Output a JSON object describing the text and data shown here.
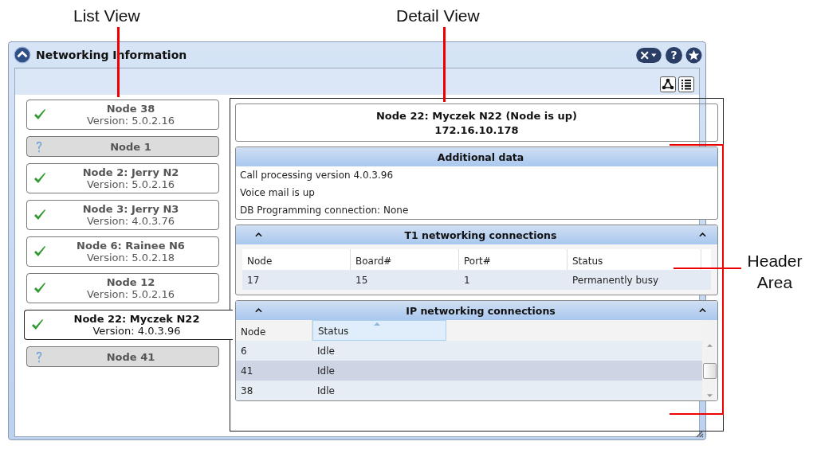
{
  "annotations": [
    {
      "label": "List View"
    },
    {
      "label": "Detail View"
    },
    {
      "label": "Header Area"
    }
  ],
  "window": {
    "title": "Networking Information",
    "help_glyph": "?"
  },
  "nodes": [
    {
      "kind": "up",
      "name": "Node 38",
      "version": "Version: 5.0.2.16",
      "selected": false
    },
    {
      "kind": "unknown",
      "name": "Node 1",
      "selected": false
    },
    {
      "kind": "up",
      "name": "Node 2: Jerry N2",
      "version": "Version: 5.0.2.16",
      "selected": false
    },
    {
      "kind": "up",
      "name": "Node 3: Jerry N3",
      "version": "Version: 4.0.3.76",
      "selected": false
    },
    {
      "kind": "up",
      "name": "Node 6: Rainee N6",
      "version": "Version: 5.0.2.18",
      "selected": false
    },
    {
      "kind": "up",
      "name": "Node 12",
      "version": "Version: 5.0.2.16",
      "selected": false
    },
    {
      "kind": "up",
      "name": "Node 22: Myczek N22",
      "version": "Version: 4.0.3.96",
      "selected": true
    },
    {
      "kind": "unknown",
      "name": "Node 41",
      "selected": false
    }
  ],
  "detail": {
    "title": "Node 22: Myczek N22 (Node is up)",
    "address": "172.16.10.178",
    "additional": {
      "title": "Additional data",
      "lines": [
        "Call processing version 4.0.3.96",
        "Voice mail is up",
        "DB Programming connection: None"
      ]
    },
    "t1": {
      "title": "T1 networking connections",
      "columns": [
        {
          "label": "Node",
          "sorted": false
        },
        {
          "label": "Board#",
          "sorted": false
        },
        {
          "label": "Port#",
          "sorted": false
        },
        {
          "label": "Status",
          "sorted": false
        }
      ],
      "rows": [
        {
          "cells": [
            "17",
            "15",
            "1",
            "Permanently busy"
          ],
          "selected": false
        }
      ]
    },
    "ip": {
      "title": "IP networking connections",
      "columns": [
        {
          "label": "Node",
          "sorted": false
        },
        {
          "label": "Status",
          "sorted": true
        }
      ],
      "rows": [
        {
          "cells": [
            "6",
            "Idle"
          ],
          "selected": false
        },
        {
          "cells": [
            "41",
            "Idle"
          ],
          "selected": true
        },
        {
          "cells": [
            "38",
            "Idle"
          ],
          "selected": false
        }
      ]
    }
  }
}
